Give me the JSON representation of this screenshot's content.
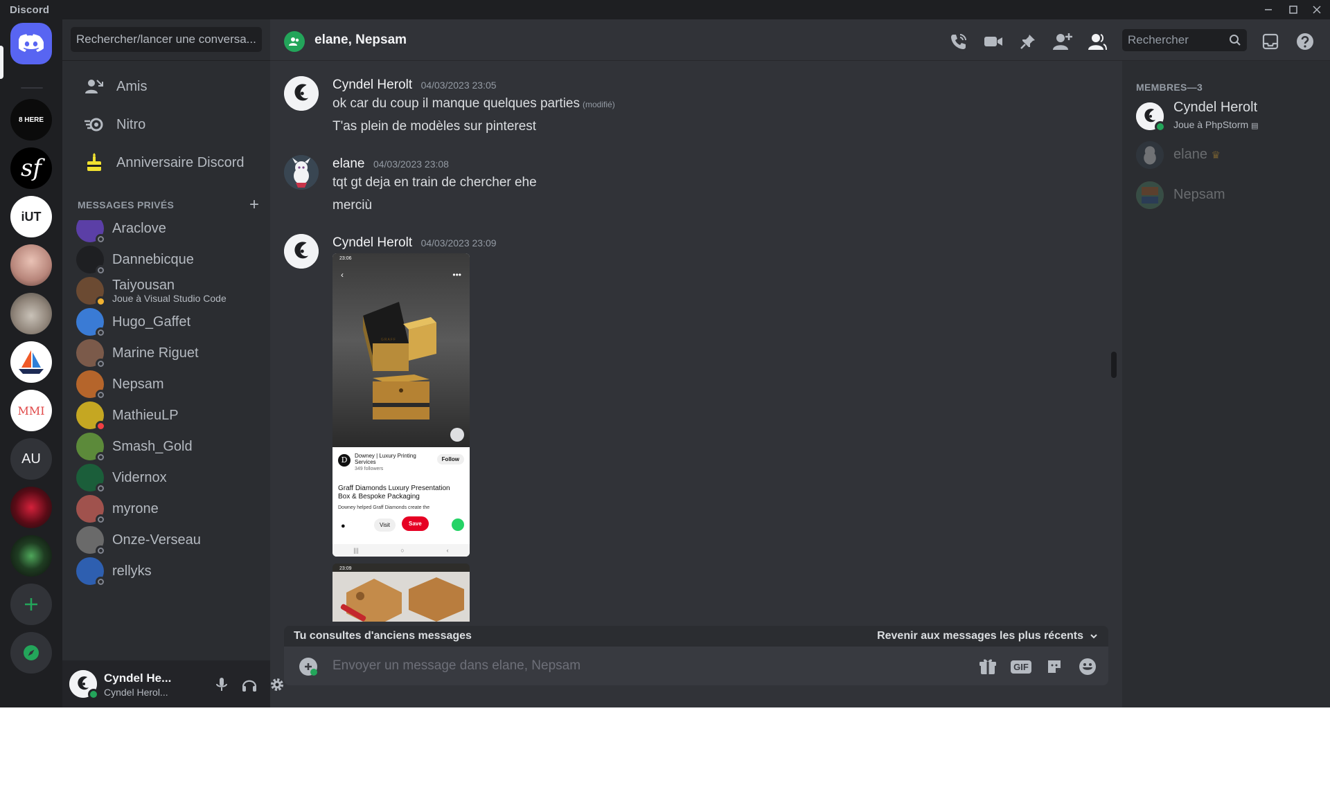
{
  "window": {
    "title": "Discord"
  },
  "dm_sidebar": {
    "search_placeholder": "Rechercher/lancer une conversa...",
    "nav": [
      {
        "label": "Amis",
        "icon": "friends-icon"
      },
      {
        "label": "Nitro",
        "icon": "nitro-icon"
      },
      {
        "label": "Anniversaire Discord",
        "icon": "cake-icon"
      }
    ],
    "dm_header": "MESSAGES PRIVÉS",
    "dms": [
      {
        "name": "Araclove",
        "status": "offline",
        "color": "#5b3fa6"
      },
      {
        "name": "Dannebicque",
        "status": "offline",
        "color": "#1e1f22"
      },
      {
        "name": "Taiyousan",
        "subtitle": "Joue à Visual Studio Code",
        "status": "idle",
        "color": "#6b4a32"
      },
      {
        "name": "Hugo_Gaffet",
        "status": "offline",
        "color": "#3a7bd5"
      },
      {
        "name": "Marine Riguet",
        "status": "offline",
        "color": "#7b5a4a"
      },
      {
        "name": "Nepsam",
        "status": "offline",
        "color": "#b5652b"
      },
      {
        "name": "MathieuLP",
        "status": "dnd",
        "color": "#c5a722"
      },
      {
        "name": "Smash_Gold",
        "status": "offline",
        "color": "#5c8a3a"
      },
      {
        "name": "Vidernox",
        "status": "offline",
        "color": "#1b5e3a"
      },
      {
        "name": "myrone",
        "status": "offline",
        "color": "#a0524d"
      },
      {
        "name": "Onze-Verseau",
        "status": "offline",
        "color": "#6a6a6a"
      },
      {
        "name": "rellyks",
        "status": "offline",
        "color": "#2e5fb0"
      }
    ]
  },
  "user_panel": {
    "name": "Cyndel He...",
    "sub": "Cyndel Herol..."
  },
  "header": {
    "title": "elane, Nepsam",
    "search_placeholder": "Rechercher"
  },
  "messages": [
    {
      "author": "Cyndel Herolt",
      "time": "04/03/2023 23:05",
      "lines": [
        "ok car du coup il manque quelques parties",
        "T'as plein de modèles sur pinterest"
      ],
      "edited": "(modifié)"
    },
    {
      "author": "elane",
      "time": "04/03/2023 23:08",
      "lines": [
        "tqt gt deja en train de chercher ehe",
        "merciù"
      ]
    },
    {
      "author": "Cyndel Herolt",
      "time": "04/03/2023 23:09",
      "attachment": {
        "time1": "23:06",
        "time2": "23:09",
        "brand_title": "Downey | Luxury Printing Services",
        "followers": "349 followers",
        "follow_label": "Follow",
        "pin_title": "Graff Diamonds Luxury Presentation Box & Bespoke Packaging",
        "pin_desc": "Downey helped Graff Diamonds create the",
        "visit_label": "Visit",
        "save_label": "Save",
        "box_label": "GRAFF"
      }
    }
  ],
  "old_messages_bar": {
    "left": "Tu consultes d'anciens messages",
    "right": "Revenir aux messages les plus récents"
  },
  "composer": {
    "placeholder": "Envoyer un message dans elane, Nepsam",
    "gif_label": "GIF"
  },
  "members": {
    "header": "MEMBRES—3",
    "list": [
      {
        "name": "Cyndel Herolt",
        "activity": "Joue à PhpStorm",
        "online": true
      },
      {
        "name": "elane",
        "owner": true,
        "online": false
      },
      {
        "name": "Nepsam",
        "online": false
      }
    ]
  },
  "servers": [
    {
      "name": "home",
      "label": ""
    },
    {
      "name": "8-here",
      "label": "8 HERE"
    },
    {
      "name": "symfony",
      "label": "sf"
    },
    {
      "name": "iut",
      "label": "iUT"
    },
    {
      "name": "photo-server",
      "label": ""
    },
    {
      "name": "cat-server",
      "label": ""
    },
    {
      "name": "boat-server",
      "label": ""
    },
    {
      "name": "mmi",
      "label": "MMI"
    },
    {
      "name": "au",
      "label": "AU"
    },
    {
      "name": "red-server",
      "label": ""
    },
    {
      "name": "green-server",
      "label": ""
    }
  ],
  "colors": {
    "accent": "#5865f2",
    "online": "#23a55a",
    "save_red": "#e60023"
  }
}
